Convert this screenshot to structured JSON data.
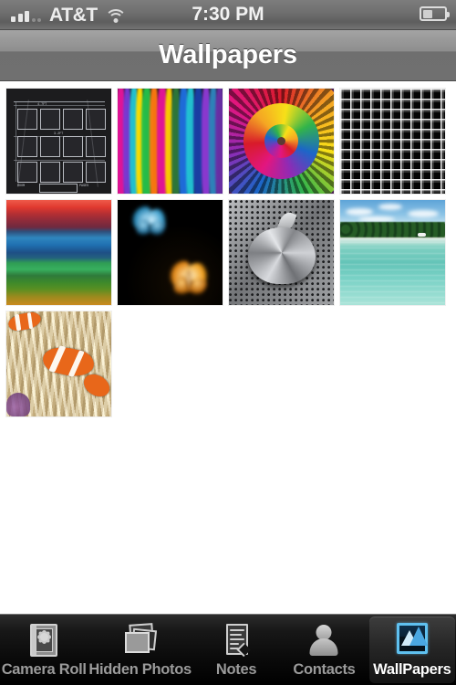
{
  "status_bar": {
    "signal_icon": "signal-bars-icon",
    "signal_bars_filled": 3,
    "signal_bars_dim": 2,
    "carrier": "AT&T",
    "wifi_icon": "wifi-icon",
    "time": "7:30 PM",
    "battery_icon": "battery-icon",
    "battery_level_percent": 45
  },
  "nav_bar": {
    "title": "Wallpapers"
  },
  "gallery": {
    "columns": 4,
    "thumbnails": [
      {
        "id": "wallpaper-1",
        "name": "blueprint-grid",
        "description": "Dark architectural blueprint with grid of framed panels and dimension lines",
        "labels": [
          "ROOM",
          "PAGES",
          "4.7FT",
          "3.2FT"
        ]
      },
      {
        "id": "wallpaper-2",
        "name": "rainbow-fibers",
        "description": "Vertical multicolored light fibers",
        "colors": [
          "#e8159a",
          "#ff7a10",
          "#ffe000",
          "#26c24a",
          "#1f6fe0",
          "#7a3ad6",
          "#22c7d6"
        ]
      },
      {
        "id": "wallpaper-3",
        "name": "rainbow-spiral",
        "description": "Rainbow spiral vortex of braided strands",
        "colors": [
          "#d81b2a",
          "#f5a623",
          "#f7e018",
          "#32b44a",
          "#1c66c8",
          "#8e2bb5",
          "#e2167f"
        ]
      },
      {
        "id": "wallpaper-4",
        "name": "black-white-plaid",
        "description": "Black and white plaid grid pattern",
        "colors": [
          "#000000",
          "#ffffff"
        ]
      },
      {
        "id": "wallpaper-5",
        "name": "color-stripes",
        "description": "Horizontal bands of red, blue, green and orange",
        "colors": [
          "#e0392f",
          "#8d2b3a",
          "#2f86bf",
          "#1e4f86",
          "#2f9d54",
          "#3f8a2a",
          "#c98a1e"
        ]
      },
      {
        "id": "wallpaper-6",
        "name": "glowing-butterflies",
        "description": "Blue and orange glowing butterflies on black",
        "colors": [
          "#000000",
          "#58c8f0",
          "#f0921a"
        ]
      },
      {
        "id": "wallpaper-7",
        "name": "metal-apple-logo",
        "description": "Brushed aluminum Apple logo on perforated metal mesh",
        "colors": [
          "#8d8f92",
          "#d8dade"
        ]
      },
      {
        "id": "wallpaper-8",
        "name": "tropical-beach",
        "description": "Turquoise lagoon, white sand beach, green island trees, blue sky",
        "colors": [
          "#5ea4d8",
          "#64c4b8",
          "#efeee3",
          "#1f4a22"
        ]
      },
      {
        "id": "wallpaper-9",
        "name": "clownfish-anemone",
        "description": "Orange clownfish among cream sea anemone tentacles",
        "colors": [
          "#e8671a",
          "#efe2bc",
          "#fdf7ef"
        ]
      }
    ]
  },
  "tab_bar": {
    "selected": "WallPapers",
    "tabs": [
      {
        "label": "Camera Roll",
        "icon": "photo-album-icon",
        "selected": false
      },
      {
        "label": "Hidden Photos",
        "icon": "stacked-photos-icon",
        "selected": false
      },
      {
        "label": "Notes",
        "icon": "note-document-icon",
        "selected": false
      },
      {
        "label": "Contacts",
        "icon": "person-icon",
        "selected": false
      },
      {
        "label": "WallPapers",
        "icon": "mountain-picture-icon",
        "selected": true
      }
    ]
  },
  "colors": {
    "status_bar_bg": "#6e6e6e",
    "nav_bar_bg": "#8e8e8e",
    "tab_bar_bg": "#0b0b0b",
    "accent_blue": "#5fc0ef",
    "content_bg": "#ffffff"
  }
}
